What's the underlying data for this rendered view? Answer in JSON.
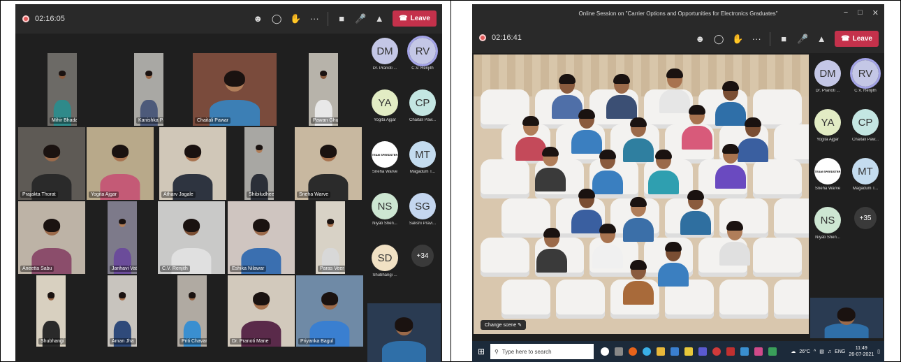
{
  "left_meeting": {
    "timer": "02:16:05",
    "leave_label": "Leave",
    "toolbar_icons": [
      "people-icon",
      "chat-icon",
      "raise-hand-icon",
      "more-icon",
      "camera-icon",
      "mic-icon",
      "share-icon"
    ],
    "participants": [
      {
        "name": "Mihir Bhadange",
        "shirt": "#2f8a8a",
        "skin": "#8a5b3e"
      },
      {
        "name": "Kanishka Pawar",
        "shirt": "#4d5a7a",
        "skin": "#9b6a4a"
      },
      {
        "name": "Chaitali Pawar",
        "shirt": "#3c7fb5",
        "skin": "#b07e5a"
      },
      {
        "name": "Pawan Ghumare",
        "shirt": "#e8e8e8",
        "skin": "#8a5b3e"
      },
      {
        "name": "Prajakta Thorat",
        "shirt": "#2a2a2a",
        "skin": "#9b6a4a"
      },
      {
        "name": "Yogita Ajgar",
        "shirt": "#c45a76",
        "skin": "#a8734f"
      },
      {
        "name": "Atharv Jagale",
        "shirt": "#2e3440",
        "skin": "#a8734f"
      },
      {
        "name": "Shibiludheen",
        "shirt": "#2b2f38",
        "skin": "#b07e5a"
      },
      {
        "name": "Sneha Warve",
        "shirt": "#2b2b2b",
        "skin": "#a8734f"
      },
      {
        "name": "Aneetta Sabu",
        "shirt": "#8b4d6b",
        "skin": "#9b6a4a"
      },
      {
        "name": "Janhavi Vatankar",
        "shirt": "#6b4c9a",
        "skin": "#b07e5a"
      },
      {
        "name": "C.V. Renjith",
        "shirt": "#e0e0e0",
        "skin": "#7a4e33"
      },
      {
        "name": "Eshika Nilawar",
        "shirt": "#3a6fb0",
        "skin": "#9b6a4a"
      },
      {
        "name": "Paras Veer",
        "shirt": "#d8d8d8",
        "skin": "#a8734f"
      },
      {
        "name": "Shubhangi Mahadev Dhage",
        "shirt": "#2a2a2a",
        "skin": "#9b6a4a"
      },
      {
        "name": "Aman Jha",
        "shirt": "#2f4a7a",
        "skin": "#a8734f"
      },
      {
        "name": "Priti Chavan",
        "shirt": "#3a8fd0",
        "skin": "#9b6a4a"
      },
      {
        "name": "Dr. Pranoti Mane",
        "shirt": "#5a2a4a",
        "skin": "#a8734f"
      },
      {
        "name": "Priyanka Bagul",
        "shirt": "#3a7fd0",
        "skin": "#9b6a4a"
      }
    ],
    "roster": [
      {
        "initials": "DM",
        "name": "Dr. Pranoti ...",
        "color": "#c4c7e6",
        "selected": false
      },
      {
        "initials": "RV",
        "name": "C.V. Renjith",
        "color": "#c4c7e6",
        "selected": true
      },
      {
        "initials": "YA",
        "name": "Yogita Ajgar",
        "color": "#e2ecc4",
        "selected": false
      },
      {
        "initials": "CP",
        "name": "Chaitali Paw...",
        "color": "#c4e6e2",
        "selected": false
      },
      {
        "initials": "",
        "name": "Sneha Warve",
        "color": "#ffffff",
        "selected": false,
        "logo": "TEAM SPEEDSTER"
      },
      {
        "initials": "MT",
        "name": "Magadum T...",
        "color": "#c4dcef",
        "selected": false
      },
      {
        "initials": "NS",
        "name": "Niyati Shen...",
        "color": "#cde6d2",
        "selected": false
      },
      {
        "initials": "SG",
        "name": "Sakshi Pravi...",
        "color": "#c4d6ef",
        "selected": false
      },
      {
        "initials": "SD",
        "name": "Shubhangi ...",
        "color": "#f1e1c4",
        "selected": false
      },
      {
        "initials": "+34",
        "name": "",
        "color": "#3a3a3a",
        "selected": false,
        "more": true
      }
    ]
  },
  "right_meeting": {
    "window_title": "Online Session on \"Carrier Options and Opportunities for Electronics Graduates\"",
    "timer": "02:16:41",
    "leave_label": "Leave",
    "change_scene_label": "Change scene",
    "roster": [
      {
        "initials": "DM",
        "name": "Dr. Pranoti ...",
        "color": "#c4c7e6",
        "selected": false
      },
      {
        "initials": "RV",
        "name": "C.V. Renjith",
        "color": "#c4c7e6",
        "selected": true
      },
      {
        "initials": "YA",
        "name": "Yogita Ajgar",
        "color": "#e2ecc4",
        "selected": false
      },
      {
        "initials": "CP",
        "name": "Chaitali Paw...",
        "color": "#c4e6e2",
        "selected": false
      },
      {
        "initials": "",
        "name": "Sneha Warve",
        "color": "#ffffff",
        "selected": false,
        "logo": "TEAM SPEEDSTER"
      },
      {
        "initials": "MT",
        "name": "Magadum T...",
        "color": "#c4dcef",
        "selected": false
      },
      {
        "initials": "NS",
        "name": "Niyati Shen...",
        "color": "#cde6d2",
        "selected": false
      },
      {
        "initials": "+35",
        "name": "",
        "color": "#3a3a3a",
        "selected": false,
        "more": true
      }
    ],
    "taskbar": {
      "search_placeholder": "Type here to search",
      "weather": "26°C",
      "language": "ENG",
      "time": "11:49",
      "date": "26-07-2021"
    },
    "audience_colors": [
      "#4f6fa8",
      "#3b4f74",
      "#e6e6e6",
      "#2f6fa8",
      "#c44a5a",
      "#3b7fc0",
      "#2f7fa0",
      "#d85a7a",
      "#3a5fa0",
      "#3a3a3a",
      "#3a7fc0",
      "#2f9fb0",
      "#6a4ac0",
      "#3a5fa0",
      "#3b6fa8",
      "#2f6fa0",
      "#3a3a3a",
      "#f0f0f0",
      "#3b7fc0",
      "#e0e0e0",
      "#a86a3a",
      "#4a6fa8",
      "#3a4f74",
      "#e8e8e8"
    ]
  }
}
